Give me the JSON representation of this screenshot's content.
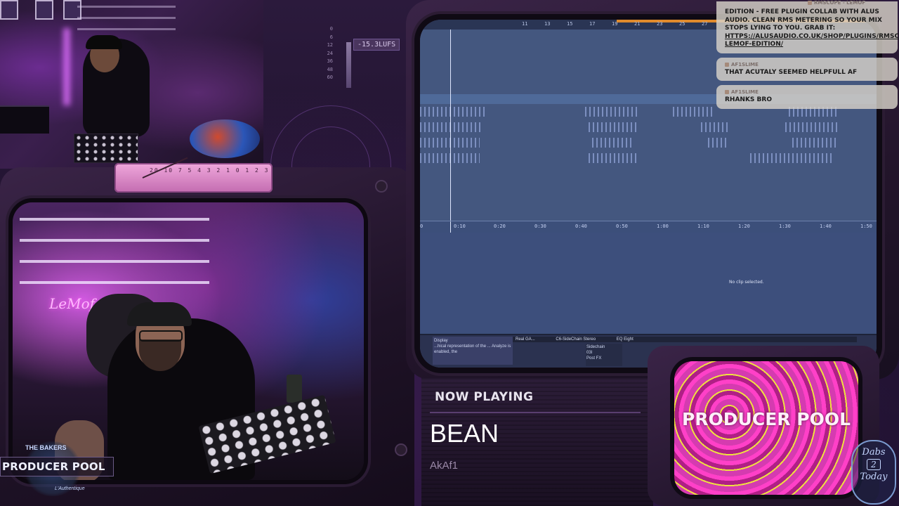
{
  "overlay": {
    "lufs_readout": "-15.3LUFS",
    "db_scale": [
      "0",
      "6",
      "12",
      "24",
      "36",
      "48",
      "60"
    ],
    "vu_scale": "20 10 7 5 4 3 2 1 0 1 2 3"
  },
  "daw": {
    "ruler_ticks": [
      "11",
      "13",
      "15",
      "17",
      "19",
      "21",
      "23",
      "25",
      "27"
    ],
    "timeline": [
      "0",
      "0:10",
      "0:20",
      "0:30",
      "0:40",
      "0:50",
      "1:00",
      "1:10",
      "1:20",
      "1:30",
      "1:40",
      "1:50"
    ],
    "no_clip_message": "No clip selected.",
    "device_display_title": "Display",
    "device_display_text": "...hical representation of the ... Analyze is enabled, the",
    "chain_devices": [
      "Real GA...",
      "C6-SideChain Stereo",
      "EQ Eight"
    ],
    "sidechain_label": "Sidechain",
    "sidechain_source": "03I",
    "sidechain_tap": "Post FX"
  },
  "chat": {
    "messages": [
      {
        "user": "RMSCOPE - LEMOF",
        "text": "EDITION - FREE PLUGIN COLLAB WITH ALUS AUDIO. CLEAN RMS METERING SO YOUR MIX STOPS LYING TO YOU. GRAB IT:",
        "link": "HTTPS://ALUSAUDIO.CO.UK/SHOP/PLUGINS/RMSCOPE-LEMOF-EDITION/"
      },
      {
        "user": "AF1SLIME",
        "text": "THAT ACUTALY SEEMED HELPFULL AF"
      },
      {
        "user": "AF1SLIME",
        "text": "RHANKS BRO"
      }
    ]
  },
  "now_playing": {
    "label": "NOW PLAYING",
    "title": "BEAN",
    "artist": "AkAf1"
  },
  "branding": {
    "producer_pool_badge": "PRODUCER POOL",
    "producer_pool_tv": "PRODUCER POOL",
    "logo_top": "THE BAKERS",
    "logo_bottom": "L'Authentique",
    "dabs_line1": "Dabs",
    "dabs_line2": "2",
    "dabs_line3": "Today",
    "neon_sign": "LeMof"
  }
}
